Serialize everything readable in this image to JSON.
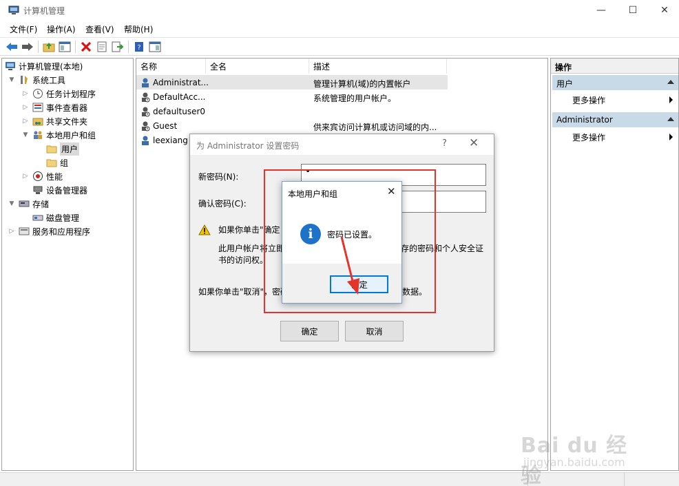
{
  "window": {
    "title": "计算机管理",
    "minimize": "—",
    "maximize": "☐",
    "close": "✕"
  },
  "menu": [
    "文件(F)",
    "操作(A)",
    "查看(V)",
    "帮助(H)"
  ],
  "tree": {
    "root": "计算机管理(本地)",
    "items": [
      {
        "label": "系统工具"
      },
      {
        "label": "任务计划程序"
      },
      {
        "label": "事件查看器"
      },
      {
        "label": "共享文件夹"
      },
      {
        "label": "本地用户和组"
      },
      {
        "label": "用户"
      },
      {
        "label": "组"
      },
      {
        "label": "性能"
      },
      {
        "label": "设备管理器"
      },
      {
        "label": "存储"
      },
      {
        "label": "磁盘管理"
      },
      {
        "label": "服务和应用程序"
      }
    ]
  },
  "list": {
    "columns": [
      "名称",
      "全名",
      "描述"
    ],
    "rows": [
      {
        "name": "Administrat...",
        "desc": "管理计算机(域)的内置帐户"
      },
      {
        "name": "DefaultAcc...",
        "desc": "系统管理的用户帐户。"
      },
      {
        "name": "defaultuser0",
        "desc": ""
      },
      {
        "name": "Guest",
        "desc": "供来宾访问计算机或访问域的内..."
      },
      {
        "name": "leexiang",
        "desc": ""
      }
    ]
  },
  "actions": {
    "title": "操作",
    "sections": [
      {
        "header": "用户",
        "item": "更多操作"
      },
      {
        "header": "Administrator",
        "item": "更多操作"
      }
    ]
  },
  "pwd_dialog": {
    "title": "为 Administrator 设置密码",
    "help": "?",
    "close": "✕",
    "new_pwd_label": "新密码(N):",
    "confirm_pwd_label": "确认密码(C):",
    "new_pwd_value": "•",
    "confirm_pwd_value": "",
    "warn_line1": "如果你单击\"确定",
    "info_line2a": "此用户帐户将立即",
    "info_line2b": "存的密码和个人安全证",
    "info_line3": "书的访问权。",
    "cancel_line_a": "如果你单击\"取消\"，密码",
    "cancel_line_b": "数据。",
    "ok": "确定",
    "cancel": "取消"
  },
  "msgbox": {
    "title": "本地用户和组",
    "close": "✕",
    "icon": "i",
    "message": "密码已设置。",
    "ok": "确定"
  },
  "watermark": {
    "logo": "Bai du 经验",
    "url": "jingyan.baidu.com"
  },
  "colors": {
    "highlight": "#e5322d",
    "selection": "#d9d9d9",
    "action_header": "#c8d9e8",
    "info_icon": "#1e72c8"
  }
}
